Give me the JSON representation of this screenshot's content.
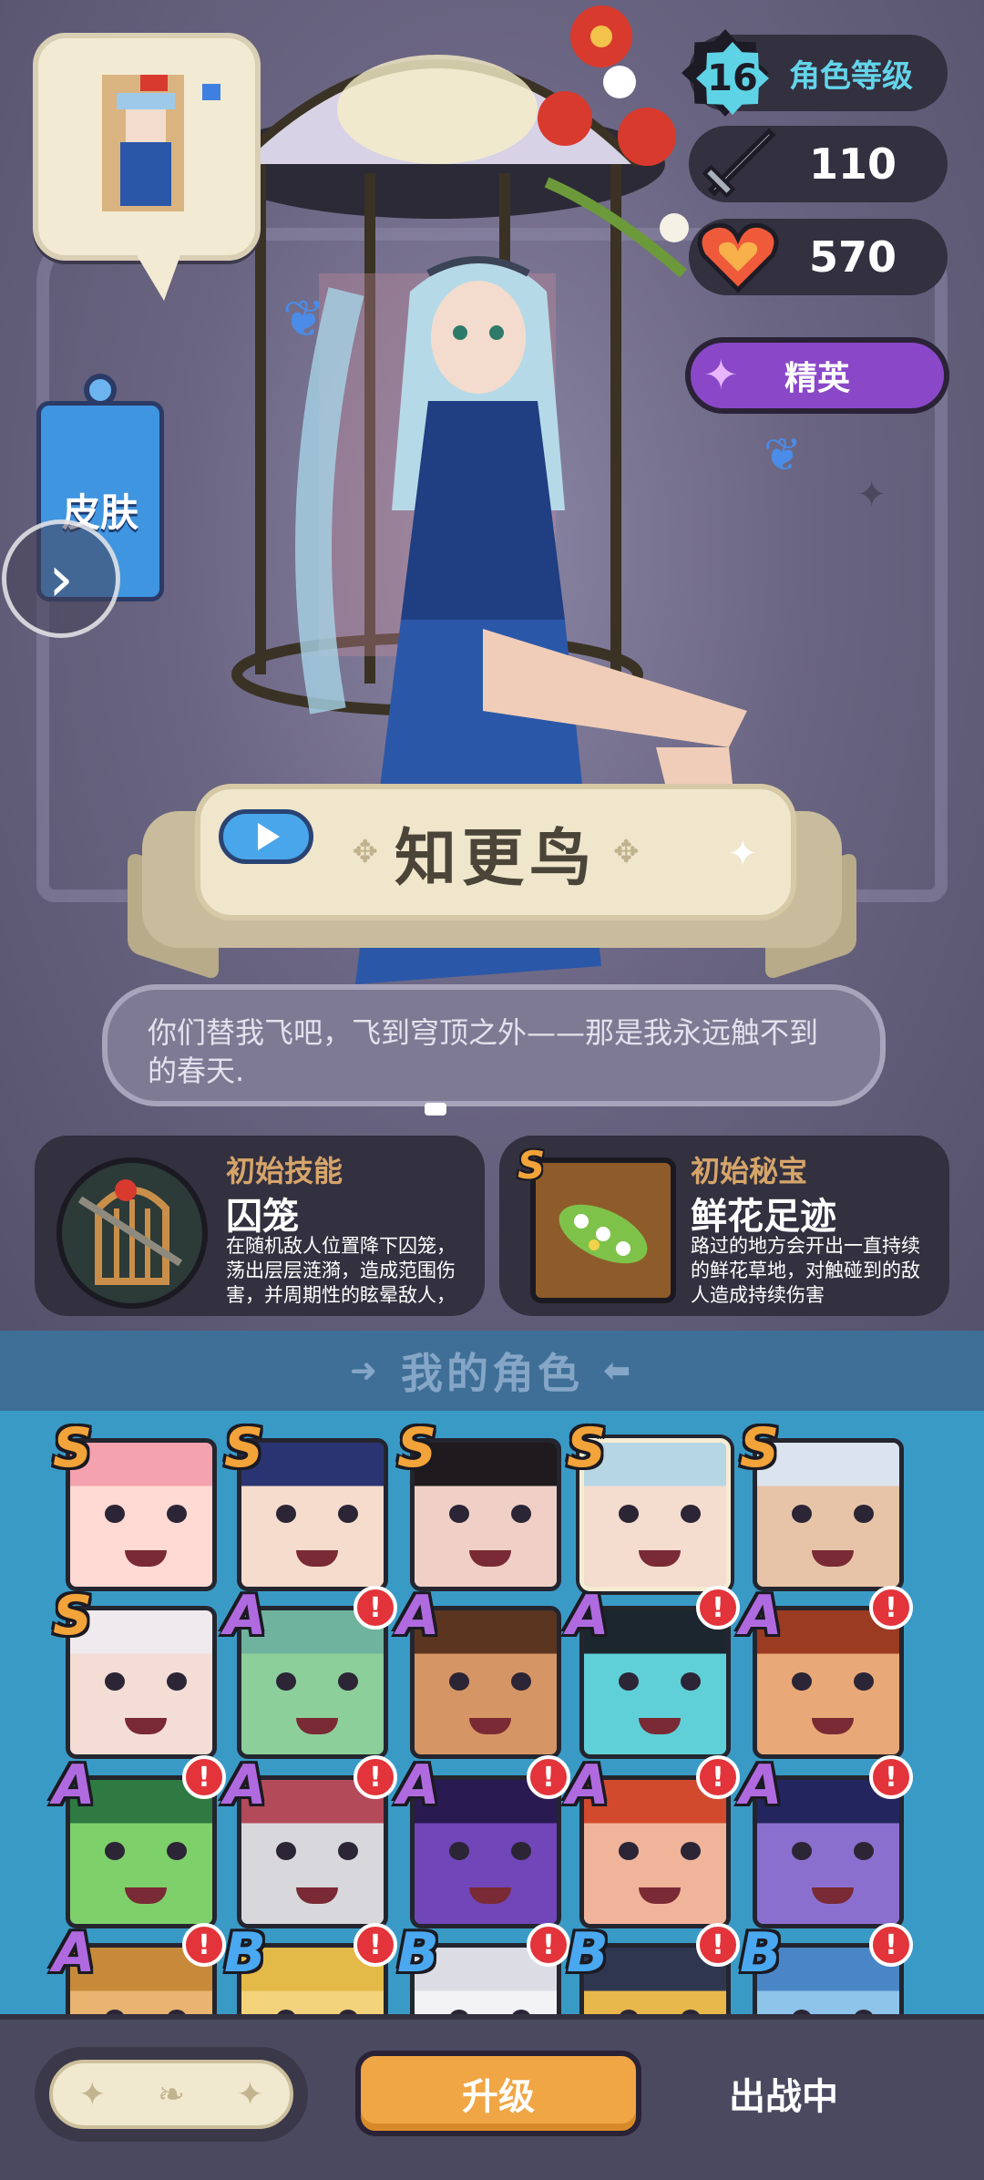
{
  "hero": {
    "name": "知更鸟",
    "quote": "你们替我飞吧，飞到穹顶之外——那是我永远触不到的春天."
  },
  "skin_tab": {
    "label": "皮肤"
  },
  "stats": {
    "level_value": "16",
    "level_label": "角色等级",
    "attack": "110",
    "health": "570"
  },
  "rarity": {
    "label": "精英"
  },
  "skill": {
    "kind": "初始技能",
    "title": "囚笼",
    "description": "在随机敌人位置降下囚笼，荡出层层涟漪，造成范围伤害，并周期性的眩晕敌人，"
  },
  "treasure": {
    "rank": "S",
    "kind": "初始秘宝",
    "title": "鲜花足迹",
    "description": "路过的地方会开出一直持续的鲜花草地，对触碰到的敌人造成持续伤害"
  },
  "roles": {
    "header": "我的角色",
    "tiles": [
      {
        "rank": "S",
        "alert": "",
        "bg": "#f2c9c9",
        "skin": "#ffd9d3",
        "hair": "#f4a3ae",
        "selected": false
      },
      {
        "rank": "S",
        "alert": "",
        "bg": "#3f4f9a",
        "skin": "#f6dccd",
        "hair": "#2a3472",
        "selected": false
      },
      {
        "rank": "S",
        "alert": "",
        "bg": "#5a3b3b",
        "skin": "#f0d0c6",
        "hair": "#1f1a1e",
        "selected": false
      },
      {
        "rank": "S",
        "alert": "",
        "bg": "#7fb6c8",
        "skin": "#f4dccf",
        "hair": "#b6d6e4",
        "selected": true
      },
      {
        "rank": "S",
        "alert": "",
        "bg": "#8fa6c8",
        "skin": "#e7c3a8",
        "hair": "#dbe3ee",
        "selected": false
      },
      {
        "rank": "S",
        "alert": "",
        "bg": "#c9c3c8",
        "skin": "#f3ddd4",
        "hair": "#eeeaee",
        "selected": false
      },
      {
        "rank": "A",
        "alert": "!",
        "bg": "#6fb39e",
        "skin": "#8ccf9a",
        "hair": "#6fb39e",
        "selected": false
      },
      {
        "rank": "A",
        "alert": "",
        "bg": "#b2743d",
        "skin": "#d69564",
        "hair": "#5b3520",
        "selected": false
      },
      {
        "rank": "A",
        "alert": "!",
        "bg": "#2d3e4a",
        "skin": "#5fd0d8",
        "hair": "#1c262e",
        "selected": false
      },
      {
        "rank": "A",
        "alert": "!",
        "bg": "#b0502e",
        "skin": "#e9a878",
        "hair": "#9a3b22",
        "selected": false
      },
      {
        "rank": "A",
        "alert": "!",
        "bg": "#3f9a5a",
        "skin": "#7ed06a",
        "hair": "#2f7a42",
        "selected": false
      },
      {
        "rank": "A",
        "alert": "!",
        "bg": "#6a6f7e",
        "skin": "#d8d8dc",
        "hair": "#b34a5a",
        "selected": false
      },
      {
        "rank": "A",
        "alert": "!",
        "bg": "#4a2f86",
        "skin": "#7046b8",
        "hair": "#2a1a52",
        "selected": false
      },
      {
        "rank": "A",
        "alert": "!",
        "bg": "#c0503a",
        "skin": "#f0b49a",
        "hair": "#d24a2e",
        "selected": false
      },
      {
        "rank": "A",
        "alert": "!",
        "bg": "#3b3f8e",
        "skin": "#8b6fcf",
        "hair": "#23265e",
        "selected": false
      },
      {
        "rank": "A",
        "alert": "!",
        "bg": "#c78a3a",
        "skin": "#e8b470",
        "hair": "#c78a3a",
        "selected": false
      },
      {
        "rank": "B",
        "alert": "!",
        "bg": "#e3b948",
        "skin": "#f2d27a",
        "hair": "#e3b948",
        "selected": false
      },
      {
        "rank": "B",
        "alert": "!",
        "bg": "#dcdce4",
        "skin": "#f3f3f6",
        "hair": "#dcdce4",
        "selected": false
      },
      {
        "rank": "B",
        "alert": "!",
        "bg": "#2e3650",
        "skin": "#e9b84a",
        "hair": "#2e3650",
        "selected": false
      },
      {
        "rank": "B",
        "alert": "!",
        "bg": "#4a86c6",
        "skin": "#8ec4ea",
        "hair": "#4a86c6",
        "selected": false
      }
    ]
  },
  "bottom": {
    "upgrade_label": "升级",
    "status_label": "出战中"
  },
  "colors": {
    "accent_orange": "#f0a644",
    "elite_purple": "#8a48c8",
    "level_cyan": "#5fd3e6",
    "roles_panel": "#3a9ac6"
  }
}
